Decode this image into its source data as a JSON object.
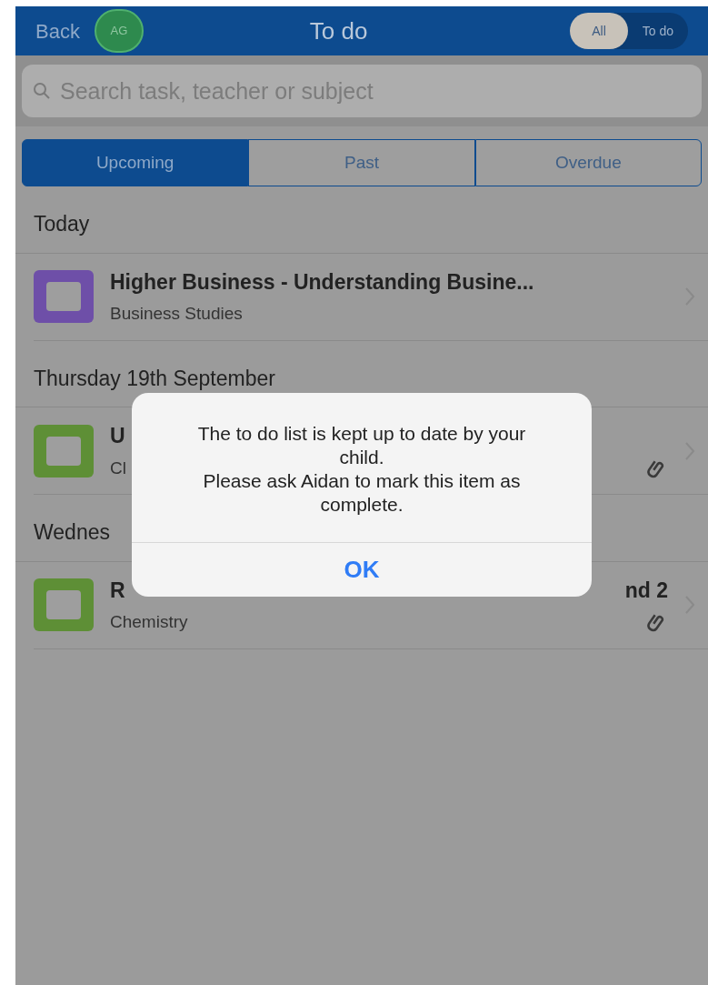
{
  "header": {
    "back": "Back",
    "avatar": "AG",
    "title": "To do",
    "filter": [
      {
        "label": "All",
        "selected": true
      },
      {
        "label": "To do",
        "selected": false
      }
    ]
  },
  "search": {
    "placeholder": "Search task, teacher or subject"
  },
  "tabs": [
    {
      "label": "Upcoming",
      "selected": true
    },
    {
      "label": "Past",
      "selected": false
    },
    {
      "label": "Overdue",
      "selected": false
    }
  ],
  "sections": [
    {
      "heading": "Today",
      "items": [
        {
          "title": "Higher Business - Understanding Busine...",
          "subtitle": "Business Studies",
          "color": "#6e4fa8",
          "attachment": false
        }
      ]
    },
    {
      "heading": "Thursday 19th September",
      "items": [
        {
          "title": "U",
          "subtitle": "Cl",
          "color": "#5e8f36",
          "attachment": true
        }
      ]
    },
    {
      "heading": "Wednes",
      "items": [
        {
          "title": "R",
          "title_end": "nd 2",
          "subtitle": "Chemistry",
          "color": "#5e8f36",
          "attachment": true
        }
      ]
    }
  ],
  "dialog": {
    "message": "The to do list is kept up to date by your child.\nPlease ask Aidan to mark this item as complete.",
    "button": "OK"
  }
}
